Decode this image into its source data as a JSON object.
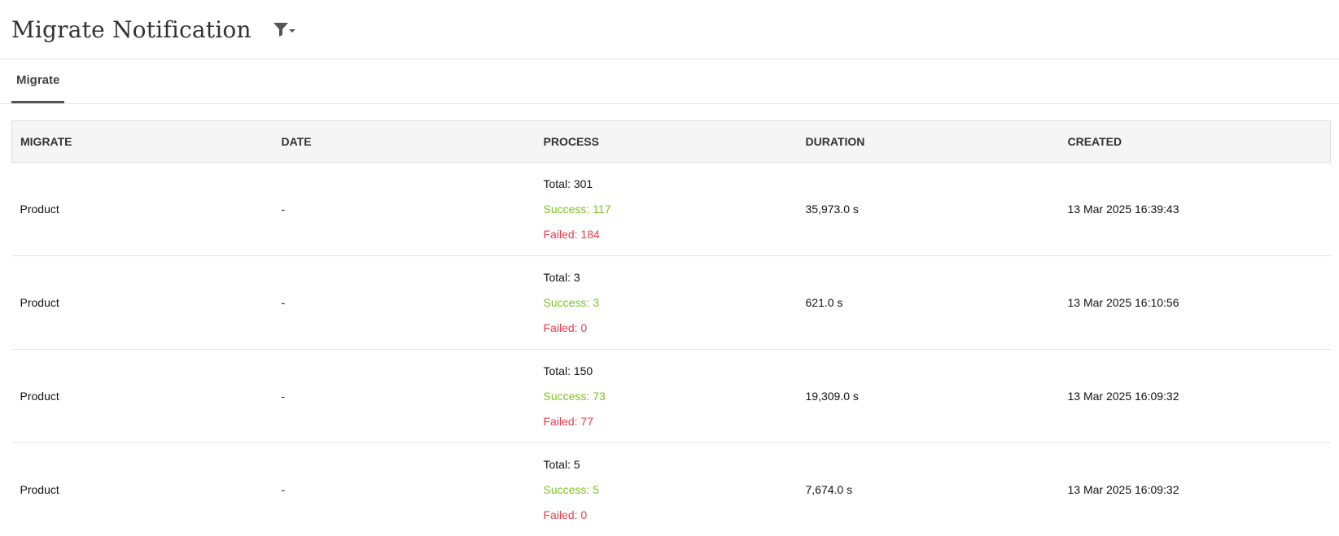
{
  "header": {
    "title": "Migrate Notification",
    "filter_icon": "filter-icon"
  },
  "tabs": [
    {
      "label": "Migrate",
      "active": true
    }
  ],
  "table": {
    "columns": [
      "MIGRATE",
      "DATE",
      "PROCESS",
      "DURATION",
      "CREATED"
    ],
    "rows": [
      {
        "migrate": "Product",
        "date": "-",
        "process": {
          "total": "Total: 301",
          "success": "Success: 117",
          "failed": "Failed: 184"
        },
        "duration": "35,973.0 s",
        "created": "13 Mar 2025 16:39:43"
      },
      {
        "migrate": "Product",
        "date": "-",
        "process": {
          "total": "Total: 3",
          "success": "Success: 3",
          "failed": "Failed: 0"
        },
        "duration": "621.0 s",
        "created": "13 Mar 2025 16:10:56"
      },
      {
        "migrate": "Product",
        "date": "-",
        "process": {
          "total": "Total: 150",
          "success": "Success: 73",
          "failed": "Failed: 77"
        },
        "duration": "19,309.0 s",
        "created": "13 Mar 2025 16:09:32"
      },
      {
        "migrate": "Product",
        "date": "-",
        "process": {
          "total": "Total: 5",
          "success": "Success: 5",
          "failed": "Failed: 0"
        },
        "duration": "7,674.0 s",
        "created": "13 Mar 2025 16:09:32"
      }
    ]
  },
  "colors": {
    "success": "#7cc41e",
    "failed": "#f0384a",
    "header_bg": "#f5f5f5"
  }
}
